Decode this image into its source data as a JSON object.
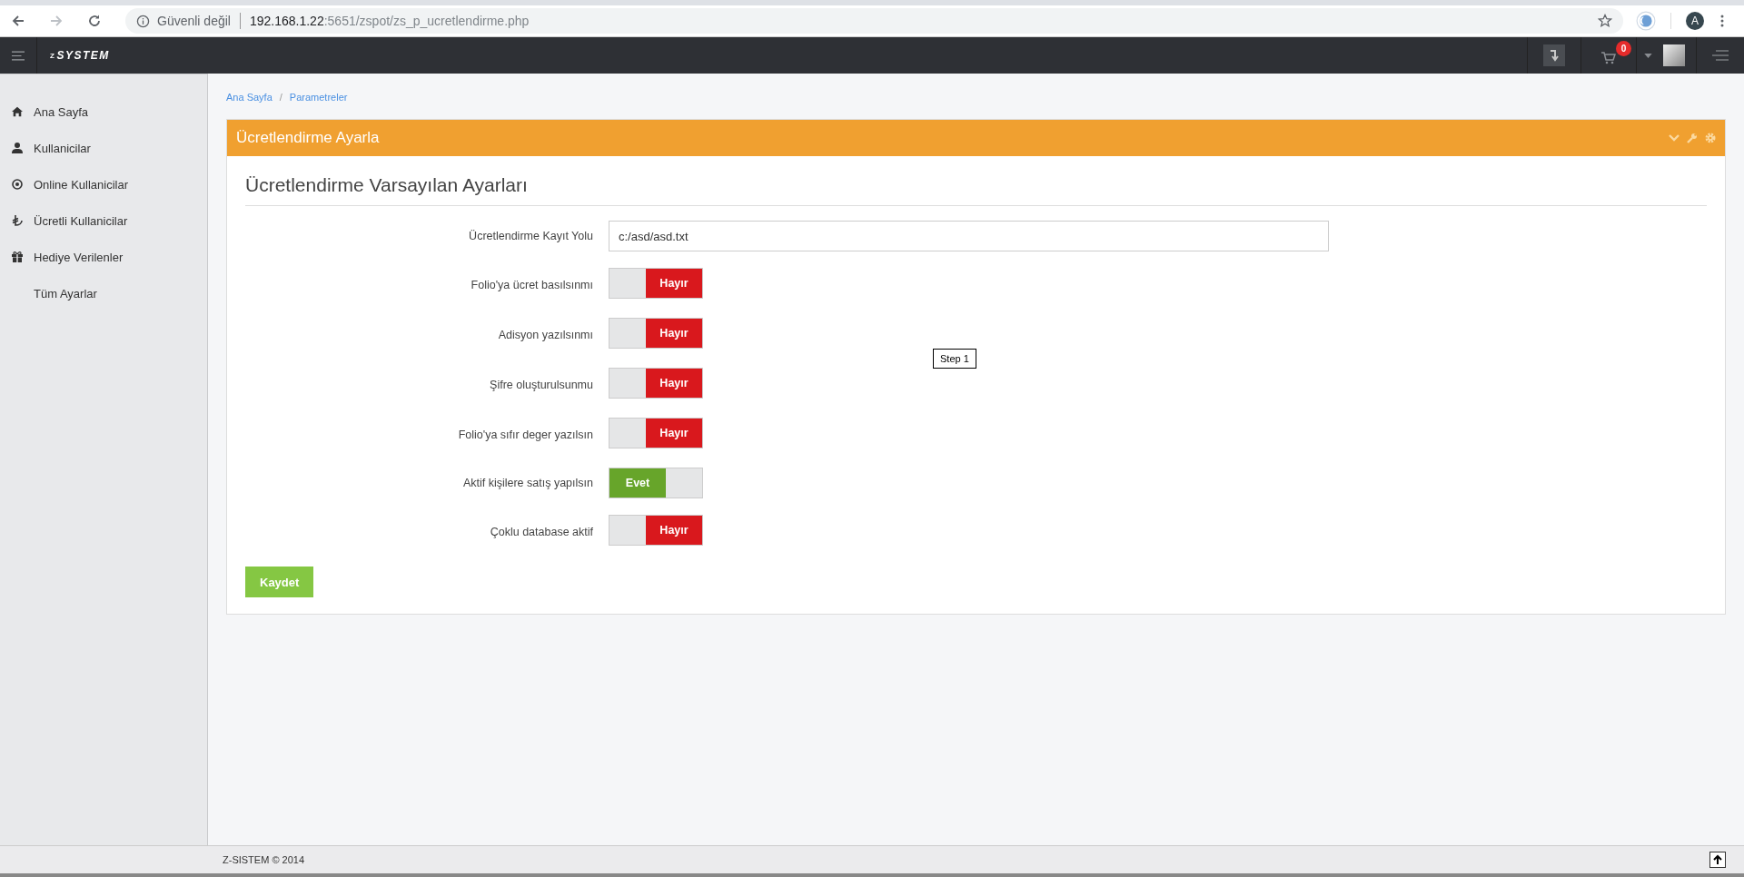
{
  "browser": {
    "security_label": "Güvenli değil",
    "url_host": "192.168.1.22",
    "url_path": ":5651/zspot/zs_p_ucretlendirme.php",
    "profile_initial": "A"
  },
  "header": {
    "logo_prefix": "Z",
    "logo": "SYSTEM",
    "cart_count": "0"
  },
  "sidebar": {
    "items": [
      {
        "label": "Ana Sayfa"
      },
      {
        "label": "Kullanicilar"
      },
      {
        "label": "Online Kullanicilar"
      },
      {
        "label": "Ücretli Kullanicilar"
      },
      {
        "label": "Hediye Verilenler"
      },
      {
        "label": "Tüm Ayarlar"
      }
    ]
  },
  "breadcrumb": [
    "Ana Sayfa",
    "Parametreler"
  ],
  "breadcrumb_separator": "/",
  "panel": {
    "title": "Ücretlendirme Ayarla",
    "heading": "Ücretlendirme Varsayılan Ayarları",
    "fields": [
      {
        "kind": "text",
        "label": "Ücretlendirme Kayıt Yolu",
        "value": "c:/asd/asd.txt"
      },
      {
        "kind": "toggle",
        "label": "Folio'ya ücret basılsınmı",
        "on": false,
        "state_label": "Hayır"
      },
      {
        "kind": "toggle",
        "label": "Adisyon yazılsınmı",
        "on": false,
        "state_label": "Hayır"
      },
      {
        "kind": "toggle",
        "label": "Şifre oluşturulsunmu",
        "on": false,
        "state_label": "Hayır"
      },
      {
        "kind": "toggle",
        "label": "Folio'ya sıfır deger yazılsın",
        "on": false,
        "state_label": "Hayır"
      },
      {
        "kind": "toggle",
        "label": "Aktif kişilere satış yapılsın",
        "on": true,
        "state_label": "Evet"
      },
      {
        "kind": "toggle",
        "label": "Çoklu database aktif",
        "on": false,
        "state_label": "Hayır"
      }
    ],
    "save_button": "Kaydet"
  },
  "tooltip": "Step 1",
  "footer": "Z-SISTEM © 2014"
}
